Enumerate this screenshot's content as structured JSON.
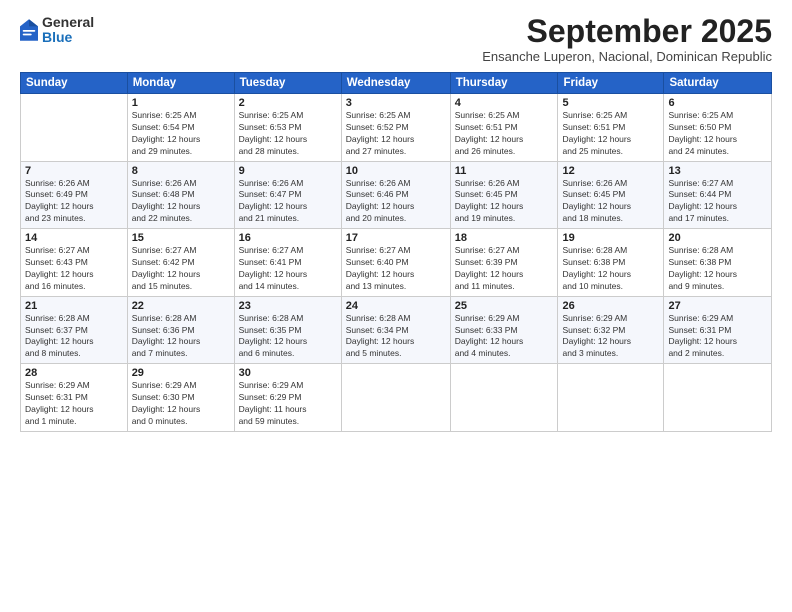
{
  "logo": {
    "general": "General",
    "blue": "Blue"
  },
  "header": {
    "month_title": "September 2025",
    "subtitle": "Ensanche Luperon, Nacional, Dominican Republic"
  },
  "weekdays": [
    "Sunday",
    "Monday",
    "Tuesday",
    "Wednesday",
    "Thursday",
    "Friday",
    "Saturday"
  ],
  "weeks": [
    [
      {
        "day": "",
        "info": ""
      },
      {
        "day": "1",
        "info": "Sunrise: 6:25 AM\nSunset: 6:54 PM\nDaylight: 12 hours\nand 29 minutes."
      },
      {
        "day": "2",
        "info": "Sunrise: 6:25 AM\nSunset: 6:53 PM\nDaylight: 12 hours\nand 28 minutes."
      },
      {
        "day": "3",
        "info": "Sunrise: 6:25 AM\nSunset: 6:52 PM\nDaylight: 12 hours\nand 27 minutes."
      },
      {
        "day": "4",
        "info": "Sunrise: 6:25 AM\nSunset: 6:51 PM\nDaylight: 12 hours\nand 26 minutes."
      },
      {
        "day": "5",
        "info": "Sunrise: 6:25 AM\nSunset: 6:51 PM\nDaylight: 12 hours\nand 25 minutes."
      },
      {
        "day": "6",
        "info": "Sunrise: 6:25 AM\nSunset: 6:50 PM\nDaylight: 12 hours\nand 24 minutes."
      }
    ],
    [
      {
        "day": "7",
        "info": "Sunrise: 6:26 AM\nSunset: 6:49 PM\nDaylight: 12 hours\nand 23 minutes."
      },
      {
        "day": "8",
        "info": "Sunrise: 6:26 AM\nSunset: 6:48 PM\nDaylight: 12 hours\nand 22 minutes."
      },
      {
        "day": "9",
        "info": "Sunrise: 6:26 AM\nSunset: 6:47 PM\nDaylight: 12 hours\nand 21 minutes."
      },
      {
        "day": "10",
        "info": "Sunrise: 6:26 AM\nSunset: 6:46 PM\nDaylight: 12 hours\nand 20 minutes."
      },
      {
        "day": "11",
        "info": "Sunrise: 6:26 AM\nSunset: 6:45 PM\nDaylight: 12 hours\nand 19 minutes."
      },
      {
        "day": "12",
        "info": "Sunrise: 6:26 AM\nSunset: 6:45 PM\nDaylight: 12 hours\nand 18 minutes."
      },
      {
        "day": "13",
        "info": "Sunrise: 6:27 AM\nSunset: 6:44 PM\nDaylight: 12 hours\nand 17 minutes."
      }
    ],
    [
      {
        "day": "14",
        "info": "Sunrise: 6:27 AM\nSunset: 6:43 PM\nDaylight: 12 hours\nand 16 minutes."
      },
      {
        "day": "15",
        "info": "Sunrise: 6:27 AM\nSunset: 6:42 PM\nDaylight: 12 hours\nand 15 minutes."
      },
      {
        "day": "16",
        "info": "Sunrise: 6:27 AM\nSunset: 6:41 PM\nDaylight: 12 hours\nand 14 minutes."
      },
      {
        "day": "17",
        "info": "Sunrise: 6:27 AM\nSunset: 6:40 PM\nDaylight: 12 hours\nand 13 minutes."
      },
      {
        "day": "18",
        "info": "Sunrise: 6:27 AM\nSunset: 6:39 PM\nDaylight: 12 hours\nand 11 minutes."
      },
      {
        "day": "19",
        "info": "Sunrise: 6:28 AM\nSunset: 6:38 PM\nDaylight: 12 hours\nand 10 minutes."
      },
      {
        "day": "20",
        "info": "Sunrise: 6:28 AM\nSunset: 6:38 PM\nDaylight: 12 hours\nand 9 minutes."
      }
    ],
    [
      {
        "day": "21",
        "info": "Sunrise: 6:28 AM\nSunset: 6:37 PM\nDaylight: 12 hours\nand 8 minutes."
      },
      {
        "day": "22",
        "info": "Sunrise: 6:28 AM\nSunset: 6:36 PM\nDaylight: 12 hours\nand 7 minutes."
      },
      {
        "day": "23",
        "info": "Sunrise: 6:28 AM\nSunset: 6:35 PM\nDaylight: 12 hours\nand 6 minutes."
      },
      {
        "day": "24",
        "info": "Sunrise: 6:28 AM\nSunset: 6:34 PM\nDaylight: 12 hours\nand 5 minutes."
      },
      {
        "day": "25",
        "info": "Sunrise: 6:29 AM\nSunset: 6:33 PM\nDaylight: 12 hours\nand 4 minutes."
      },
      {
        "day": "26",
        "info": "Sunrise: 6:29 AM\nSunset: 6:32 PM\nDaylight: 12 hours\nand 3 minutes."
      },
      {
        "day": "27",
        "info": "Sunrise: 6:29 AM\nSunset: 6:31 PM\nDaylight: 12 hours\nand 2 minutes."
      }
    ],
    [
      {
        "day": "28",
        "info": "Sunrise: 6:29 AM\nSunset: 6:31 PM\nDaylight: 12 hours\nand 1 minute."
      },
      {
        "day": "29",
        "info": "Sunrise: 6:29 AM\nSunset: 6:30 PM\nDaylight: 12 hours\nand 0 minutes."
      },
      {
        "day": "30",
        "info": "Sunrise: 6:29 AM\nSunset: 6:29 PM\nDaylight: 11 hours\nand 59 minutes."
      },
      {
        "day": "",
        "info": ""
      },
      {
        "day": "",
        "info": ""
      },
      {
        "day": "",
        "info": ""
      },
      {
        "day": "",
        "info": ""
      }
    ]
  ]
}
